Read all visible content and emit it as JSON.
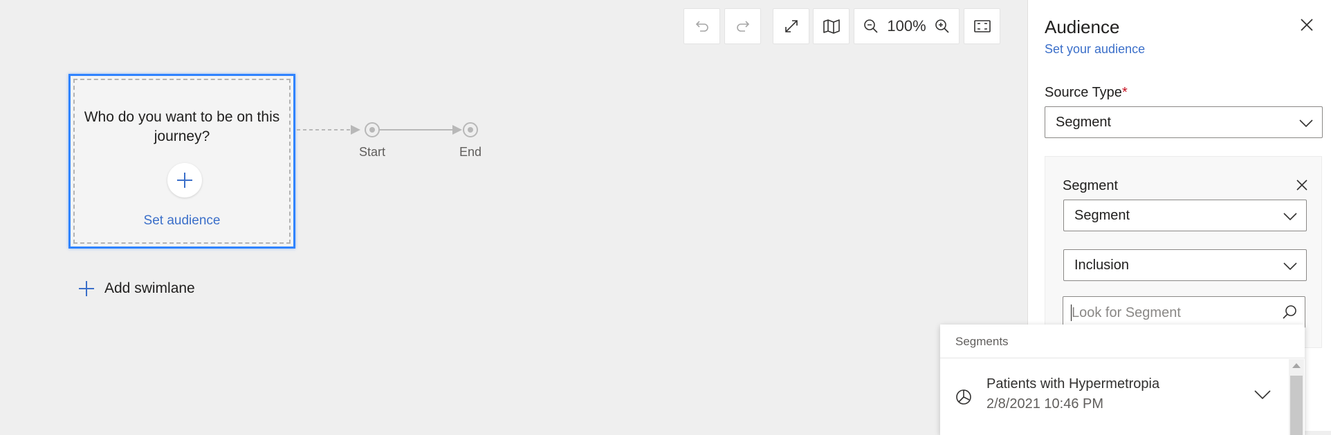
{
  "toolbar": {
    "undo_icon": "undo-icon",
    "redo_icon": "redo-icon",
    "expand_icon": "expand-icon",
    "map_icon": "map-icon",
    "zoom_out_icon": "zoom-out-icon",
    "zoom_level": "100%",
    "zoom_in_icon": "zoom-in-icon",
    "fit_icon": "fit-to-screen-icon"
  },
  "canvas": {
    "tile_title": "Who do you want to be on this journey?",
    "tile_link": "Set audience",
    "start_label": "Start",
    "end_label": "End",
    "add_swimlane": "Add swimlane"
  },
  "panel": {
    "title": "Audience",
    "subtitle": "Set your audience",
    "source_type_label": "Source Type",
    "required_mark": "*",
    "source_type_value": "Segment",
    "segment_label": "Segment",
    "segment_dropdown_value": "Segment",
    "inclusion_value": "Inclusion",
    "search_placeholder": "Look for Segment"
  },
  "suggestions": {
    "header": "Segments",
    "items": [
      {
        "name": "Patients with Hypermetropia",
        "date": "2/8/2021 10:46 PM"
      }
    ]
  },
  "colors": {
    "accent": "#2f83ff",
    "link": "#3b6fc9",
    "required": "#c50f1f"
  }
}
